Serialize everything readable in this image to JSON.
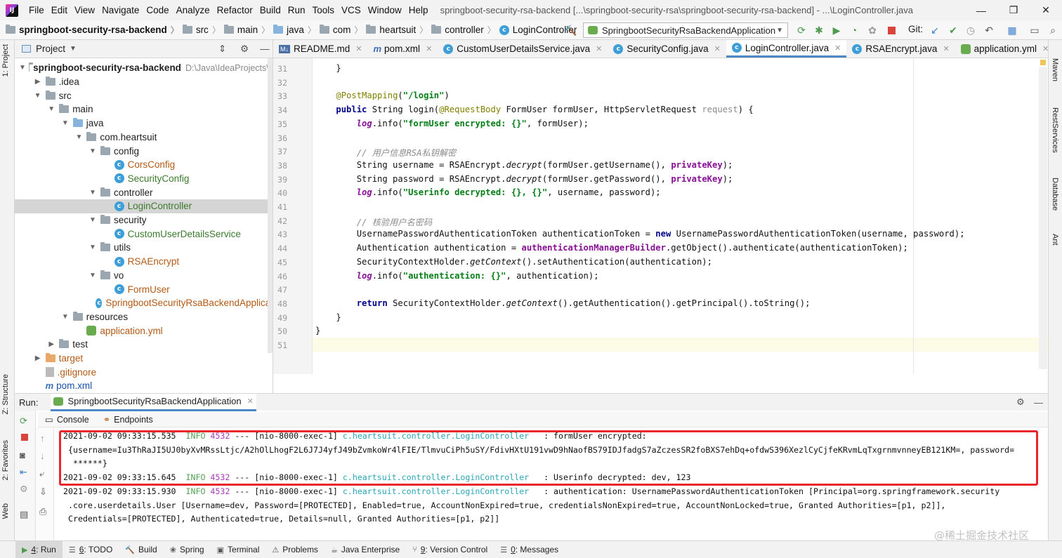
{
  "menubar": {
    "logo_label": "IJ",
    "items": [
      "File",
      "Edit",
      "View",
      "Navigate",
      "Code",
      "Analyze",
      "Refactor",
      "Build",
      "Run",
      "Tools",
      "VCS",
      "Window",
      "Help"
    ],
    "window_title": "springboot-security-rsa-backend [...\\springboot-security-rsa\\springboot-security-rsa-backend] - ...\\LoginController.java"
  },
  "navbar": {
    "breadcrumbs": [
      "springboot-security-rsa-backend",
      "src",
      "main",
      "java",
      "com",
      "heartsuit",
      "controller",
      "LoginController"
    ],
    "run_config": "SpringbootSecurityRsaBackendApplication",
    "git_label": "Git:"
  },
  "left_strip": {
    "project_tab": "1: Project",
    "structure_tab": "Z: Structure",
    "favorites_tab": "2: Favorites",
    "web_tab": "Web"
  },
  "right_strip": {
    "maven_tab": "Maven",
    "rest_tab": "RestServices",
    "database_tab": "Database",
    "ant_tab": "Ant"
  },
  "project": {
    "title": "Project",
    "tree": [
      {
        "label": "springboot-security-rsa-backend",
        "extra": "D:\\Java\\IdeaProjects\\c",
        "depth": 0,
        "expanded": true,
        "kind": "module",
        "bold": true
      },
      {
        "label": ".idea",
        "depth": 1,
        "expanded": false,
        "kind": "folder"
      },
      {
        "label": "src",
        "depth": 1,
        "expanded": true,
        "kind": "folder"
      },
      {
        "label": "main",
        "depth": 2,
        "expanded": true,
        "kind": "folder"
      },
      {
        "label": "java",
        "depth": 3,
        "expanded": true,
        "kind": "folder-blue"
      },
      {
        "label": "com.heartsuit",
        "depth": 4,
        "expanded": true,
        "kind": "folder"
      },
      {
        "label": "config",
        "depth": 5,
        "expanded": true,
        "kind": "folder"
      },
      {
        "label": "CorsConfig",
        "depth": 6,
        "kind": "class",
        "color": "red"
      },
      {
        "label": "SecurityConfig",
        "depth": 6,
        "kind": "class",
        "color": "green"
      },
      {
        "label": "controller",
        "depth": 5,
        "expanded": true,
        "kind": "folder"
      },
      {
        "label": "LoginController",
        "depth": 6,
        "kind": "class",
        "color": "green",
        "selected": true
      },
      {
        "label": "security",
        "depth": 5,
        "expanded": true,
        "kind": "folder"
      },
      {
        "label": "CustomUserDetailsService",
        "depth": 6,
        "kind": "class",
        "color": "green"
      },
      {
        "label": "utils",
        "depth": 5,
        "expanded": true,
        "kind": "folder"
      },
      {
        "label": "RSAEncrypt",
        "depth": 6,
        "kind": "class",
        "color": "red"
      },
      {
        "label": "vo",
        "depth": 5,
        "expanded": true,
        "kind": "folder"
      },
      {
        "label": "FormUser",
        "depth": 6,
        "kind": "class",
        "color": "red"
      },
      {
        "label": "SpringbootSecurityRsaBackendApplicat",
        "depth": 5,
        "kind": "app",
        "color": "red"
      },
      {
        "label": "resources",
        "depth": 3,
        "expanded": true,
        "kind": "folder"
      },
      {
        "label": "application.yml",
        "depth": 4,
        "kind": "yml",
        "color": "red"
      },
      {
        "label": "test",
        "depth": 2,
        "expanded": false,
        "kind": "folder"
      },
      {
        "label": "target",
        "depth": 1,
        "expanded": false,
        "kind": "folder-orange",
        "color": "orange"
      },
      {
        "label": ".gitignore",
        "depth": 1,
        "kind": "git",
        "color": "red"
      },
      {
        "label": "pom.xml",
        "depth": 1,
        "kind": "maven",
        "color": "blue"
      }
    ]
  },
  "editor_tabs": [
    {
      "label": "README.md",
      "icon": "markdown-icon",
      "active": false
    },
    {
      "label": "pom.xml",
      "icon": "maven-icon",
      "active": false
    },
    {
      "label": "CustomUserDetailsService.java",
      "icon": "class-icon",
      "active": false
    },
    {
      "label": "SecurityConfig.java",
      "icon": "class-icon",
      "active": false
    },
    {
      "label": "LoginController.java",
      "icon": "class-icon",
      "active": true
    },
    {
      "label": "RSAEncrypt.java",
      "icon": "class-icon",
      "active": false
    },
    {
      "label": "application.yml",
      "icon": "yml-icon",
      "active": false
    }
  ],
  "editor": {
    "line_numbers": [
      "31",
      "32",
      "33",
      "34",
      "35",
      "36",
      "37",
      "38",
      "39",
      "40",
      "41",
      "42",
      "43",
      "44",
      "45",
      "46",
      "47",
      "48",
      "49",
      "50",
      "51"
    ],
    "lines": [
      [
        {
          "t": "    }",
          "c": ""
        }
      ],
      [],
      [
        {
          "t": "    ",
          "c": ""
        },
        {
          "t": "@PostMapping",
          "c": "ann"
        },
        {
          "t": "(",
          "c": ""
        },
        {
          "t": "\"/login\"",
          "c": "str"
        },
        {
          "t": ")",
          "c": ""
        }
      ],
      [
        {
          "t": "    ",
          "c": ""
        },
        {
          "t": "public ",
          "c": "kw"
        },
        {
          "t": "String login(",
          "c": ""
        },
        {
          "t": "@RequestBody ",
          "c": "ann"
        },
        {
          "t": "FormUser formUser, HttpServletRequest ",
          "c": ""
        },
        {
          "t": "request",
          "c": "par"
        },
        {
          "t": ") {",
          "c": ""
        }
      ],
      [
        {
          "t": "        ",
          "c": ""
        },
        {
          "t": "log",
          "c": "log"
        },
        {
          "t": ".info(",
          "c": ""
        },
        {
          "t": "\"formUser encrypted: {}\"",
          "c": "str"
        },
        {
          "t": ", formUser);",
          "c": ""
        }
      ],
      [],
      [
        {
          "t": "        ",
          "c": ""
        },
        {
          "t": "// 用户信息RSA私钥解密",
          "c": "cmt"
        }
      ],
      [
        {
          "t": "        String username = RSAEncrypt.",
          "c": ""
        },
        {
          "t": "decrypt",
          "c": "ital"
        },
        {
          "t": "(formUser.getUsername(), ",
          "c": ""
        },
        {
          "t": "privateKey",
          "c": "fld"
        },
        {
          "t": ");",
          "c": ""
        }
      ],
      [
        {
          "t": "        String password = RSAEncrypt.",
          "c": ""
        },
        {
          "t": "decrypt",
          "c": "ital"
        },
        {
          "t": "(formUser.getPassword(), ",
          "c": ""
        },
        {
          "t": "privateKey",
          "c": "fld"
        },
        {
          "t": ");",
          "c": ""
        }
      ],
      [
        {
          "t": "        ",
          "c": ""
        },
        {
          "t": "log",
          "c": "log"
        },
        {
          "t": ".info(",
          "c": ""
        },
        {
          "t": "\"Userinfo decrypted: {}, {}\"",
          "c": "str"
        },
        {
          "t": ", username, password);",
          "c": ""
        }
      ],
      [],
      [
        {
          "t": "        ",
          "c": ""
        },
        {
          "t": "// 核验用户名密码",
          "c": "cmt"
        }
      ],
      [
        {
          "t": "        UsernamePasswordAuthenticationToken authenticationToken = ",
          "c": ""
        },
        {
          "t": "new ",
          "c": "kw"
        },
        {
          "t": "UsernamePasswordAuthenticationToken(username, password);",
          "c": ""
        }
      ],
      [
        {
          "t": "        Authentication authentication = ",
          "c": ""
        },
        {
          "t": "authenticationManagerBuilder",
          "c": "fld"
        },
        {
          "t": ".getObject().authenticate(authenticationToken);",
          "c": ""
        }
      ],
      [
        {
          "t": "        SecurityContextHolder.",
          "c": ""
        },
        {
          "t": "getContext",
          "c": "ital"
        },
        {
          "t": "().setAuthentication(authentication);",
          "c": ""
        }
      ],
      [
        {
          "t": "        ",
          "c": ""
        },
        {
          "t": "log",
          "c": "log"
        },
        {
          "t": ".info(",
          "c": ""
        },
        {
          "t": "\"authentication: {}\"",
          "c": "str"
        },
        {
          "t": ", authentication);",
          "c": ""
        }
      ],
      [],
      [
        {
          "t": "        ",
          "c": ""
        },
        {
          "t": "return ",
          "c": "kw"
        },
        {
          "t": "SecurityContextHolder.",
          "c": ""
        },
        {
          "t": "getContext",
          "c": "ital"
        },
        {
          "t": "().getAuthentication().getPrincipal().toString();",
          "c": ""
        }
      ],
      [
        {
          "t": "    }",
          "c": ""
        }
      ],
      [
        {
          "t": "}",
          "c": ""
        }
      ],
      []
    ]
  },
  "run": {
    "label": "Run:",
    "tab": "SpringbootSecurityRsaBackendApplication",
    "subtabs": [
      "Console",
      "Endpoints"
    ],
    "console": [
      [
        {
          "t": "2021-09-02 09:33:15.535  ",
          "c": ""
        },
        {
          "t": "INFO",
          "c": "c-info"
        },
        {
          "t": " ",
          "c": ""
        },
        {
          "t": "4532",
          "c": "c-pid"
        },
        {
          "t": " --- [nio-8000-exec-1] ",
          "c": ""
        },
        {
          "t": "c.heartsuit.controller.LoginController",
          "c": "c-cls"
        },
        {
          "t": "   : formUser encrypted:",
          "c": ""
        }
      ],
      [
        {
          "t": " {username=Iu3ThRaJI5UJ0byXvMRssLtjc/A2hOlLhogF2L6J7J4yfJ49bZvmkoWr4lFIE/TlmvuCiPh5uSY/FdivHXtU191vwD9hNaofBS79IDJfadgS7aZczesSR2foBXS7ehDq+ofdwS396XezlCyCjfeKRvmLqTxgrnmvnneyEB121KM=, password=",
          "c": ""
        }
      ],
      [
        {
          "t": "  ******}",
          "c": ""
        }
      ],
      [
        {
          "t": "2021-09-02 09:33:15.645  ",
          "c": ""
        },
        {
          "t": "INFO",
          "c": "c-info"
        },
        {
          "t": " ",
          "c": ""
        },
        {
          "t": "4532",
          "c": "c-pid"
        },
        {
          "t": " --- [nio-8000-exec-1] ",
          "c": ""
        },
        {
          "t": "c.heartsuit.controller.LoginController",
          "c": "c-cls"
        },
        {
          "t": "   : Userinfo decrypted: dev, 123",
          "c": ""
        }
      ],
      [
        {
          "t": "2021-09-02 09:33:15.930  ",
          "c": ""
        },
        {
          "t": "INFO",
          "c": "c-info"
        },
        {
          "t": " ",
          "c": ""
        },
        {
          "t": "4532",
          "c": "c-pid"
        },
        {
          "t": " --- [nio-8000-exec-1] ",
          "c": ""
        },
        {
          "t": "c.heartsuit.controller.LoginController",
          "c": "c-cls"
        },
        {
          "t": "   : authentication: UsernamePasswordAuthenticationToken [Principal=org.springframework.security",
          "c": ""
        }
      ],
      [
        {
          "t": " .core.userdetails.User [Username=dev, Password=[PROTECTED], Enabled=true, AccountNonExpired=true, credentialsNonExpired=true, AccountNonLocked=true, Granted Authorities=[p1, p2]],",
          "c": ""
        }
      ],
      [
        {
          "t": " Credentials=[PROTECTED], Authenticated=true, Details=null, Granted Authorities=[p1, p2]]",
          "c": ""
        }
      ]
    ]
  },
  "bottom_bar": [
    {
      "key": "4",
      "label": ": Run",
      "icon": "play-icon",
      "active": true
    },
    {
      "key": "6",
      "label": ": TODO",
      "icon": "list-icon",
      "active": false
    },
    {
      "key": "",
      "label": "Build",
      "icon": "hammer-icon",
      "active": false
    },
    {
      "key": "",
      "label": "Spring",
      "icon": "spring-icon",
      "active": false
    },
    {
      "key": "",
      "label": "Terminal",
      "icon": "terminal-icon",
      "active": false
    },
    {
      "key": "",
      "label": "Problems",
      "icon": "warning-icon",
      "active": false
    },
    {
      "key": "",
      "label": "Java Enterprise",
      "icon": "java-icon",
      "active": false
    },
    {
      "key": "9",
      "label": ": Version Control",
      "icon": "vcs-icon",
      "active": false
    },
    {
      "key": "0",
      "label": ": Messages",
      "icon": "messages-icon",
      "active": false
    }
  ],
  "watermark": "@稀土掘金技术社区",
  "colors": {
    "accent": "#4a88c7",
    "highlight_border": "#e8262b",
    "selection": "#d5d5d5"
  }
}
